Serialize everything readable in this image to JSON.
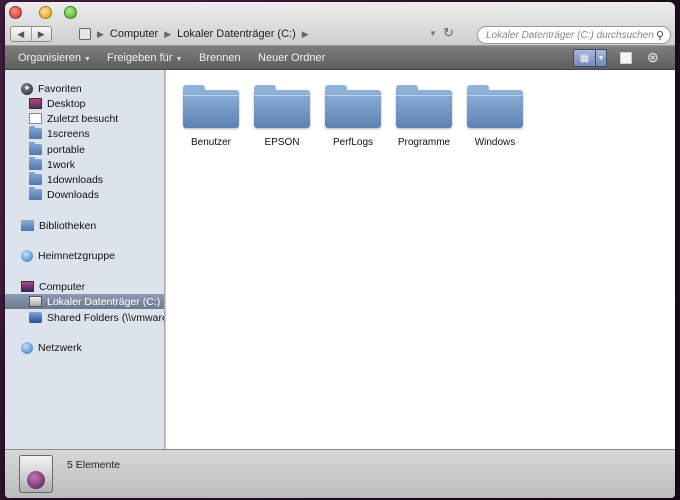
{
  "titlebar": {
    "breadcrumbs": [
      "Computer",
      "Lokaler Datenträger (C:)"
    ],
    "search_placeholder": "Lokaler Datenträger (C:) durchsuchen",
    "back_glyph": "◀",
    "forward_glyph": "▶"
  },
  "toolbar": {
    "organize": "Organisieren",
    "share": "Freigeben für",
    "burn": "Brennen",
    "new_folder": "Neuer Ordner"
  },
  "sidebar": {
    "favorites": {
      "label": "Favoriten",
      "items": [
        {
          "label": "Desktop",
          "icon": "desktop-icon"
        },
        {
          "label": "Zuletzt besucht",
          "icon": "recent-places-icon"
        },
        {
          "label": "1screens",
          "icon": "folder-icon"
        },
        {
          "label": "portable",
          "icon": "folder-icon"
        },
        {
          "label": "1work",
          "icon": "folder-icon"
        },
        {
          "label": "1downloads",
          "icon": "folder-icon"
        },
        {
          "label": "Downloads",
          "icon": "folder-icon"
        }
      ]
    },
    "libraries": "Bibliotheken",
    "homegroup": "Heimnetzgruppe",
    "computer": {
      "label": "Computer",
      "items": [
        {
          "label": "Lokaler Datenträger (C:)",
          "icon": "drive-icon",
          "selected": true
        },
        {
          "label": "Shared Folders (\\\\vmware-ho",
          "icon": "shared-folder-icon",
          "selected": false
        }
      ]
    },
    "network": "Netzwerk"
  },
  "content": {
    "folders": [
      "Benutzer",
      "EPSON",
      "PerfLogs",
      "Programme",
      "Windows"
    ]
  },
  "statusbar": {
    "count": "5 Elemente"
  },
  "colors": {
    "sidebar_bg": "#dce3ec",
    "toolbar_bg": "#6e6e6e",
    "folder_blue": "#6f95c4",
    "selection": "#7a879c"
  }
}
